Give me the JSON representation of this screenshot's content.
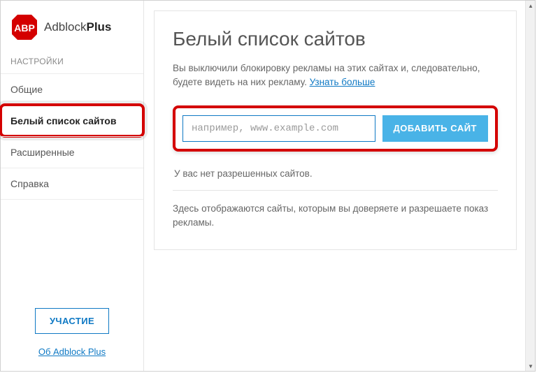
{
  "brand": {
    "name_light": "Adblock",
    "name_bold": "Plus"
  },
  "sidebar": {
    "section_label": "НАСТРОЙКИ",
    "items": [
      {
        "label": "Общие"
      },
      {
        "label": "Белый список сайтов"
      },
      {
        "label": "Расширенные"
      },
      {
        "label": "Справка"
      }
    ],
    "active_index": 1,
    "participate_label": "УЧАСТИЕ",
    "about_link": "Об Adblock Plus"
  },
  "main": {
    "title": "Белый список сайтов",
    "desc_prefix": "Вы выключили блокировку рекламы на этих сайтах и, следовательно, будете видеть на них рекламу. ",
    "learn_more": "Узнать больше",
    "input_placeholder": "например, www.example.com",
    "add_button": "ДОБАВИТЬ САЙТ",
    "empty_msg": "У вас нет разрешенных сайтов.",
    "hint": "Здесь отображаются сайты, которым вы доверяете и разрешаете показ рекламы."
  }
}
